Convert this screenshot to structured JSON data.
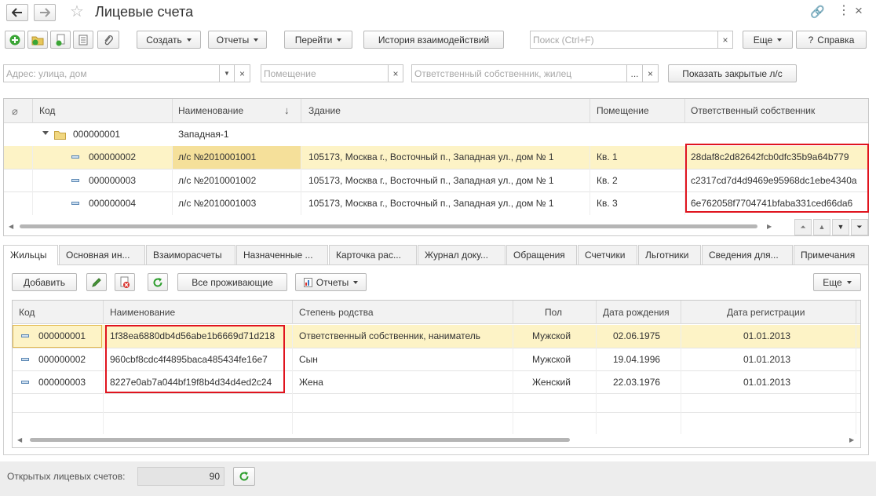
{
  "window": {
    "title": "Лицевые счета"
  },
  "toolbar": {
    "create_label": "Создать",
    "reports_label": "Отчеты",
    "goto_label": "Перейти",
    "history_label": "История взаимодействий",
    "search_placeholder": "Поиск (Ctrl+F)",
    "more_label": "Еще",
    "help_label": "Справка"
  },
  "filters": {
    "address_placeholder": "Адрес: улица, дом",
    "room_placeholder": "Помещение",
    "owner_placeholder": "Ответственный собственник, жилец",
    "show_closed_label": "Показать закрытые л/с"
  },
  "accounts_table": {
    "columns": [
      "Код",
      "Наименование",
      "Здание",
      "Помещение",
      "Ответственный собственник"
    ],
    "group": {
      "code": "000000001",
      "name": "Западная-1"
    },
    "rows": [
      {
        "code": "000000002",
        "name": "л/с №2010001001",
        "building": "105173, Москва г., Восточный п., Западная ул., дом № 1",
        "room": "Кв. 1",
        "owner": "28daf8c2d82642fcb0dfc35b9a64b779"
      },
      {
        "code": "000000003",
        "name": "л/с №2010001002",
        "building": "105173, Москва г., Восточный п., Западная ул., дом № 1",
        "room": "Кв. 2",
        "owner": "c2317cd7d4d9469e95968dc1ebe4340a"
      },
      {
        "code": "000000004",
        "name": "л/с №2010001003",
        "building": "105173, Москва г., Восточный п., Западная ул., дом № 1",
        "room": "Кв. 3",
        "owner": "6e762058f7704741bfaba331ced66da6"
      }
    ]
  },
  "tabs": [
    "Жильцы",
    "Основная ин...",
    "Взаиморасчеты",
    "Назначенные ...",
    "Карточка рас...",
    "Журнал доку...",
    "Обращения",
    "Счетчики",
    "Льготники",
    "Сведения для...",
    "Примечания"
  ],
  "residents_toolbar": {
    "add_label": "Добавить",
    "all_residents_label": "Все проживающие",
    "reports_label": "Отчеты",
    "more_label": "Еще"
  },
  "residents_table": {
    "columns": [
      "Код",
      "Наименование",
      "Степень родства",
      "Пол",
      "Дата рождения",
      "Дата регистрации"
    ],
    "rows": [
      {
        "code": "000000001",
        "name": "1f38ea6880db4d56abe1b6669d71d218",
        "relation": "Ответственный собственник, наниматель",
        "sex": "Мужской",
        "birth": "02.06.1975",
        "reg": "01.01.2013"
      },
      {
        "code": "000000002",
        "name": "960cbf8cdc4f4895baca485434fe16e7",
        "relation": "Сын",
        "sex": "Мужской",
        "birth": "19.04.1996",
        "reg": "01.01.2013"
      },
      {
        "code": "000000003",
        "name": "8227e0ab7a044bf19f8b4d34d4ed2c24",
        "relation": "Жена",
        "sex": "Женский",
        "birth": "22.03.1976",
        "reg": "01.01.2013"
      }
    ]
  },
  "footer": {
    "open_accounts_label": "Открытых лицевых счетов:",
    "open_accounts_value": "90"
  },
  "colors": {
    "selected_row": "#fdf3c6",
    "highlight": "#e0141e",
    "green_icon": "#2e9e2e"
  }
}
